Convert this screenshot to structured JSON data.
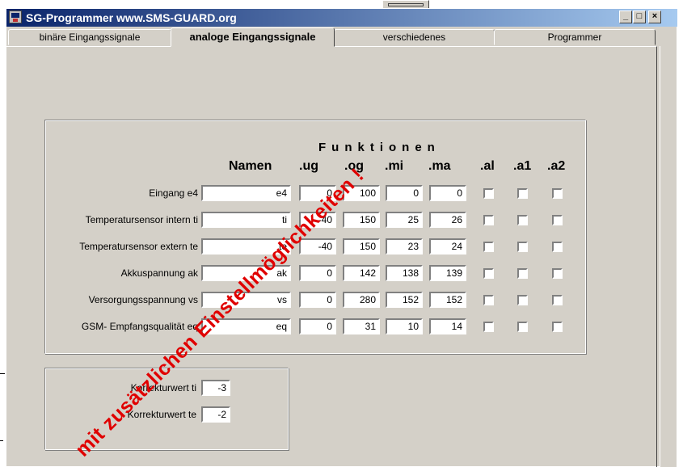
{
  "window": {
    "title": "SG-Programmer  www.SMS-GUARD.org",
    "controls": {
      "minimize": "_",
      "restore": "□",
      "close": "×"
    }
  },
  "tabs": [
    {
      "label": "binäre Eingangssignale",
      "active": false
    },
    {
      "label": "analoge Eingangssignale",
      "active": true
    },
    {
      "label": "verschiedenes",
      "active": false
    },
    {
      "label": "Programmer",
      "active": false
    }
  ],
  "analog": {
    "funktionen_header": "Funktionen",
    "columns": {
      "namen": "Namen",
      "ug": ".ug",
      "og": ".og",
      "mi": ".mi",
      "ma": ".ma",
      "al": ".al",
      "a1": ".a1",
      "a2": ".a2"
    },
    "rows": [
      {
        "label": "Eingang e4",
        "name": "e4",
        "ug": "0",
        "og": "100",
        "mi": "0",
        "ma": "0",
        "al": false,
        "a1": false,
        "a2": false
      },
      {
        "label": "Temperatursensor intern ti",
        "name": "ti",
        "ug": "-40",
        "og": "150",
        "mi": "25",
        "ma": "26",
        "al": false,
        "a1": false,
        "a2": false
      },
      {
        "label": "Temperatursensor extern te",
        "name": "te",
        "ug": "-40",
        "og": "150",
        "mi": "23",
        "ma": "24",
        "al": false,
        "a1": false,
        "a2": false
      },
      {
        "label": "Akkuspannung ak",
        "name": "ak",
        "ug": "0",
        "og": "142",
        "mi": "138",
        "ma": "139",
        "al": false,
        "a1": false,
        "a2": false
      },
      {
        "label": "Versorgungsspannung vs",
        "name": "vs",
        "ug": "0",
        "og": "280",
        "mi": "152",
        "ma": "152",
        "al": false,
        "a1": false,
        "a2": false
      },
      {
        "label": "GSM- Empfangsqualität eq",
        "name": "eq",
        "ug": "0",
        "og": "31",
        "mi": "10",
        "ma": "14",
        "al": false,
        "a1": false,
        "a2": false
      }
    ]
  },
  "korrektur": {
    "ti_label": "Korrekturwert ti",
    "ti_value": "-3",
    "te_label": "Korrekturwert te",
    "te_value": "-2"
  },
  "watermark": "mit zusätzlichen Einstellmöglichkeiten !",
  "colors": {
    "titlebar_start": "#0a246a",
    "titlebar_end": "#a6caf0",
    "face": "#d4d0c8",
    "watermark": "#e00000"
  }
}
